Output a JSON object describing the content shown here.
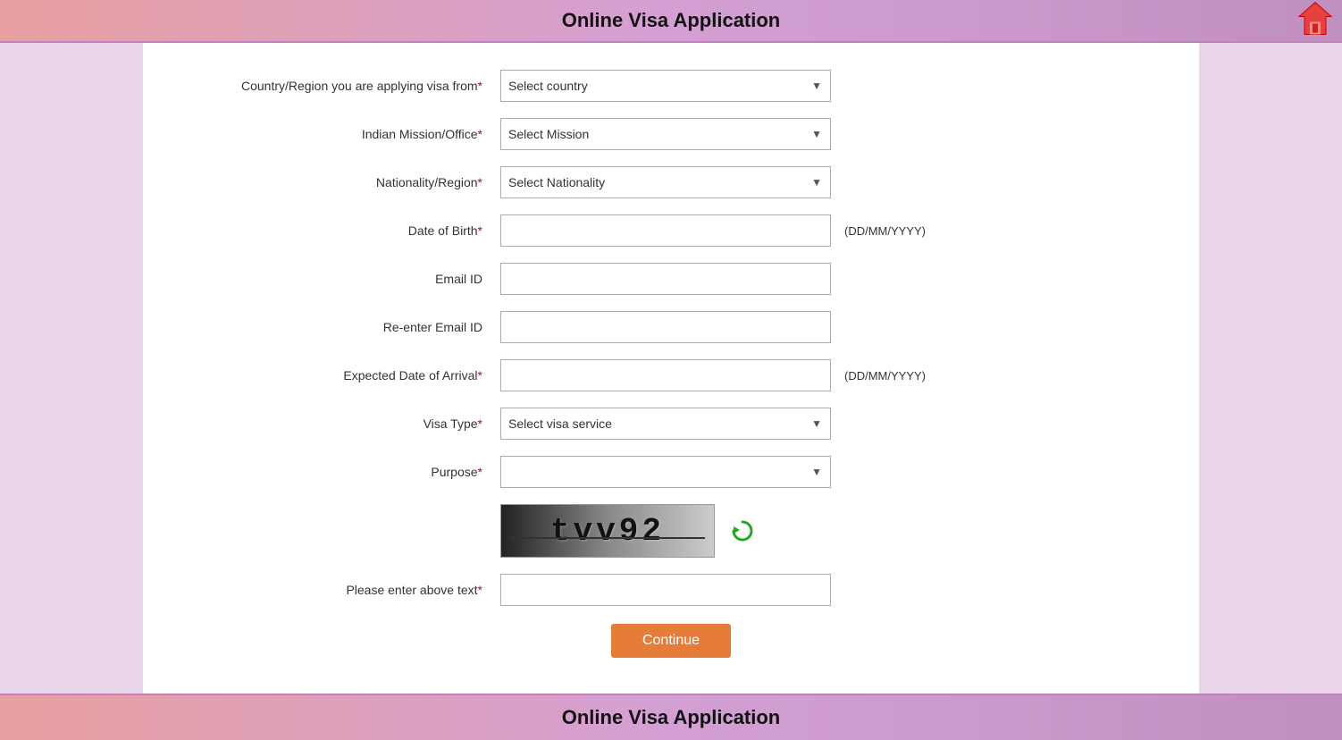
{
  "header": {
    "title": "Online Visa Application",
    "home_icon": "🏠"
  },
  "footer": {
    "title": "Online Visa Application"
  },
  "form": {
    "fields": [
      {
        "label": "Country/Region you are applying visa from",
        "required": true,
        "type": "select",
        "placeholder": "Select country",
        "name": "country-region"
      },
      {
        "label": "Indian Mission/Office",
        "required": true,
        "type": "select",
        "placeholder": "Select Mission",
        "name": "indian-mission"
      },
      {
        "label": "Nationality/Region",
        "required": true,
        "type": "select",
        "placeholder": "Select Nationality",
        "name": "nationality"
      },
      {
        "label": "Date of Birth",
        "required": true,
        "type": "text",
        "placeholder": "",
        "hint": "(DD/MM/YYYY)",
        "name": "dob"
      },
      {
        "label": "Email ID",
        "required": false,
        "type": "text",
        "placeholder": "",
        "name": "email"
      },
      {
        "label": "Re-enter Email ID",
        "required": false,
        "type": "text",
        "placeholder": "",
        "name": "re-email"
      },
      {
        "label": "Expected Date of Arrival",
        "required": true,
        "type": "text",
        "placeholder": "",
        "hint": "(DD/MM/YYYY)",
        "name": "arrival-date"
      },
      {
        "label": "Visa Type",
        "required": true,
        "type": "select",
        "placeholder": "Select visa service",
        "name": "visa-type"
      },
      {
        "label": "Purpose",
        "required": true,
        "type": "select",
        "placeholder": "",
        "name": "purpose"
      }
    ],
    "captcha": {
      "text": "tvv92",
      "label": "Please enter above text",
      "required": true
    },
    "continue_button": "Continue"
  }
}
